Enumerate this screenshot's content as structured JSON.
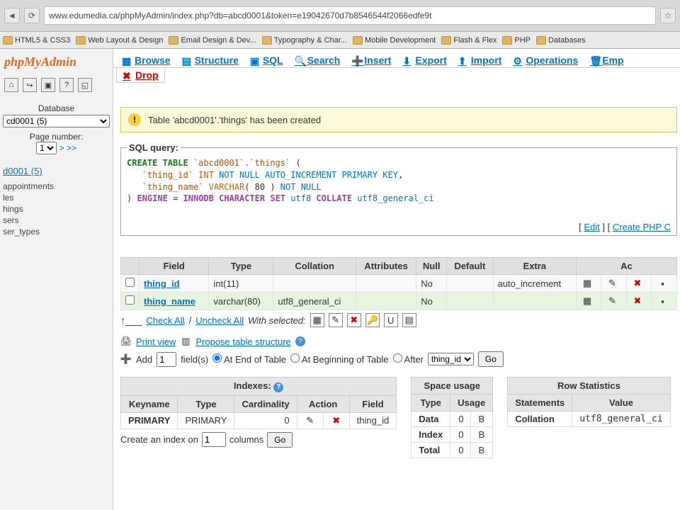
{
  "browser": {
    "url": "www.edumedia.ca/phpMyAdmin/index.php?db=abcd0001&token=e19042670d7b8546544f2066edfe9t"
  },
  "bookmarks": [
    "HTML5 & CSS3",
    "Web Layout & Design",
    "Email Design & Dev...",
    "Typography & Char...",
    "Mobile Development",
    "Flash & Flex",
    "PHP",
    "Databases"
  ],
  "sidebar": {
    "logo": "phpMyAdmin",
    "database_label": "Database",
    "db_select_value": "cd0001 (5)",
    "page_number_label": "Page number:",
    "page_number_value": "1",
    "pager": "> >>",
    "db_link": "d0001 (5)",
    "tables": [
      "appointments",
      "les",
      "hings",
      "sers",
      "ser_types"
    ]
  },
  "tabs": [
    "Browse",
    "Structure",
    "SQL",
    "Search",
    "Insert",
    "Export",
    "Import",
    "Operations",
    "Emp"
  ],
  "tabs2_drop": "Drop",
  "success": {
    "msg": "Table 'abcd0001'.'things' has been created"
  },
  "sql": {
    "legend": "SQL query:",
    "line1a": "CREATE TABLE",
    "line1b": "`abcd0001`.`things`",
    "line1c": "(",
    "line2a": "`thing_id`",
    "line2b": "INT",
    "line2c": "NOT NULL AUTO_INCREMENT PRIMARY KEY",
    "line2d": ",",
    "line3a": "`thing_name`",
    "line3b": "VARCHAR",
    "line3c": "( 80 )",
    "line3d": "NOT NULL",
    "line4a": ")",
    "line4b": "ENGINE",
    "line4c": "=",
    "line4d": "INNODB CHARACTER SET",
    "line4e": "utf8",
    "line4f": "COLLATE",
    "line4g": "utf8_general_ci",
    "edit": "Edit",
    "createphp": "Create PHP C"
  },
  "struct": {
    "headers": [
      "Field",
      "Type",
      "Collation",
      "Attributes",
      "Null",
      "Default",
      "Extra",
      "Ac"
    ],
    "rows": [
      {
        "field": "thing_id",
        "type": "int(11)",
        "collation": "",
        "attrs": "",
        "null": "No",
        "default": "",
        "extra": "auto_increment"
      },
      {
        "field": "thing_name",
        "type": "varchar(80)",
        "collation": "utf8_general_ci",
        "attrs": "",
        "null": "No",
        "default": "",
        "extra": ""
      }
    ]
  },
  "checkbar": {
    "checkall": "Check All",
    "uncheckall": "Uncheck All",
    "withsel": "With selected:"
  },
  "util": {
    "printview": "Print view",
    "propose": "Propose table structure"
  },
  "add": {
    "add": "Add",
    "value": "1",
    "fields": "field(s)",
    "opt_end": "At End of Table",
    "opt_begin": "At Beginning of Table",
    "opt_after": "After",
    "after_value": "thing_id",
    "go": "Go"
  },
  "indexes": {
    "caption": "Indexes:",
    "headers": [
      "Keyname",
      "Type",
      "Cardinality",
      "Action",
      "Field"
    ],
    "row": {
      "keyname": "PRIMARY",
      "type": "PRIMARY",
      "card": "0",
      "field": "thing_id"
    },
    "create": "Create an index on",
    "value": "1",
    "columns": "columns",
    "go": "Go"
  },
  "space": {
    "caption": "Space usage",
    "headers": [
      "Type",
      "Usage"
    ],
    "rows": [
      {
        "type": "Data",
        "usage": "0",
        "unit": "B"
      },
      {
        "type": "Index",
        "usage": "0",
        "unit": "B"
      },
      {
        "type": "Total",
        "usage": "0",
        "unit": "B"
      }
    ]
  },
  "rowstats": {
    "caption": "Row Statistics",
    "headers": [
      "Statements",
      "Value"
    ],
    "rows": [
      {
        "stmt": "Collation",
        "val": "utf8_general_ci"
      }
    ]
  }
}
